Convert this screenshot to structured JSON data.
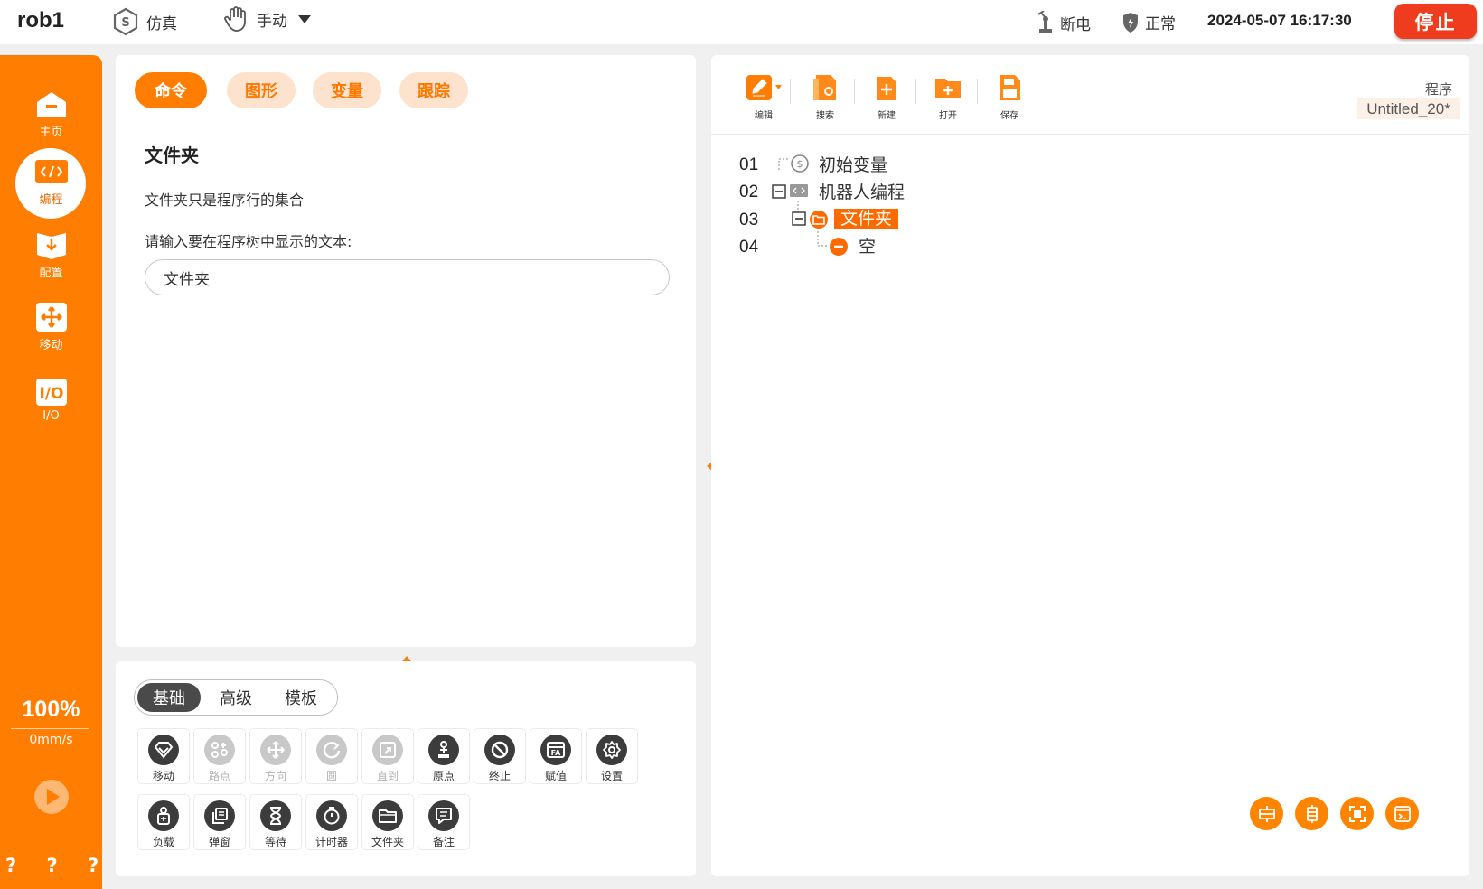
{
  "header": {
    "robot_name": "rob1",
    "sim_label": "仿真",
    "mode_label": "手动",
    "power_label": "断电",
    "status_label": "正常",
    "datetime": "2024-05-07 16:17:30",
    "stop_label": "停止"
  },
  "sidebar": {
    "items": [
      {
        "label": "主页",
        "icon": "home-icon"
      },
      {
        "label": "编程",
        "icon": "code-icon",
        "active": true
      },
      {
        "label": "配置",
        "icon": "config-icon"
      },
      {
        "label": "移动",
        "icon": "move-icon"
      },
      {
        "label": "I/O",
        "icon": "io-icon"
      }
    ],
    "speed_percent": "100%",
    "speed_value": "0mm/s",
    "help_marks": "? ? ? ?"
  },
  "command_panel": {
    "tabs": [
      "命令",
      "图形",
      "变量",
      "跟踪"
    ],
    "active_tab": "命令",
    "title": "文件夹",
    "description": "文件夹只是程序行的集合",
    "input_label": "请输入要在程序树中显示的文本:",
    "input_value": "文件夹"
  },
  "palette": {
    "segments": [
      "基础",
      "高级",
      "模板"
    ],
    "active_segment": "基础",
    "row1": [
      {
        "label": "移动",
        "icon": "move-cmd-icon",
        "enabled": true
      },
      {
        "label": "路点",
        "icon": "waypoint-icon",
        "enabled": false
      },
      {
        "label": "方向",
        "icon": "direction-icon",
        "enabled": false
      },
      {
        "label": "圆",
        "icon": "circle-icon",
        "enabled": false
      },
      {
        "label": "直到",
        "icon": "until-icon",
        "enabled": false
      },
      {
        "label": "原点",
        "icon": "origin-icon",
        "enabled": true
      },
      {
        "label": "终止",
        "icon": "halt-icon",
        "enabled": true
      },
      {
        "label": "赋值",
        "icon": "assign-icon",
        "enabled": true
      },
      {
        "label": "设置",
        "icon": "settings-icon",
        "enabled": true
      }
    ],
    "row2": [
      {
        "label": "负载",
        "icon": "payload-icon",
        "enabled": true
      },
      {
        "label": "弹窗",
        "icon": "popup-icon",
        "enabled": true
      },
      {
        "label": "等待",
        "icon": "wait-icon",
        "enabled": true
      },
      {
        "label": "计时器",
        "icon": "timer-icon",
        "enabled": true
      },
      {
        "label": "文件夹",
        "icon": "folder-icon",
        "enabled": true
      },
      {
        "label": "备注",
        "icon": "comment-icon",
        "enabled": true
      }
    ]
  },
  "program": {
    "toolbar": [
      {
        "label": "编辑",
        "icon": "edit-icon"
      },
      {
        "label": "搜索",
        "icon": "search-icon"
      },
      {
        "label": "新建",
        "icon": "new-file-icon"
      },
      {
        "label": "打开",
        "icon": "open-folder-icon"
      },
      {
        "label": "保存",
        "icon": "save-icon"
      }
    ],
    "program_label": "程序",
    "program_name": "Untitled_20*",
    "tree": [
      {
        "line": "01",
        "text": "初始变量"
      },
      {
        "line": "02",
        "text": "机器人编程"
      },
      {
        "line": "03",
        "text": "文件夹",
        "selected": true
      },
      {
        "line": "04",
        "text": "空"
      }
    ],
    "view_buttons": [
      "expand-horizontal-icon",
      "expand-vertical-icon",
      "fit-view-icon",
      "terminal-icon"
    ]
  },
  "colors": {
    "accent": "#ff7d00",
    "stop": "#f03c1e",
    "disabled": "#c8c8c8"
  }
}
